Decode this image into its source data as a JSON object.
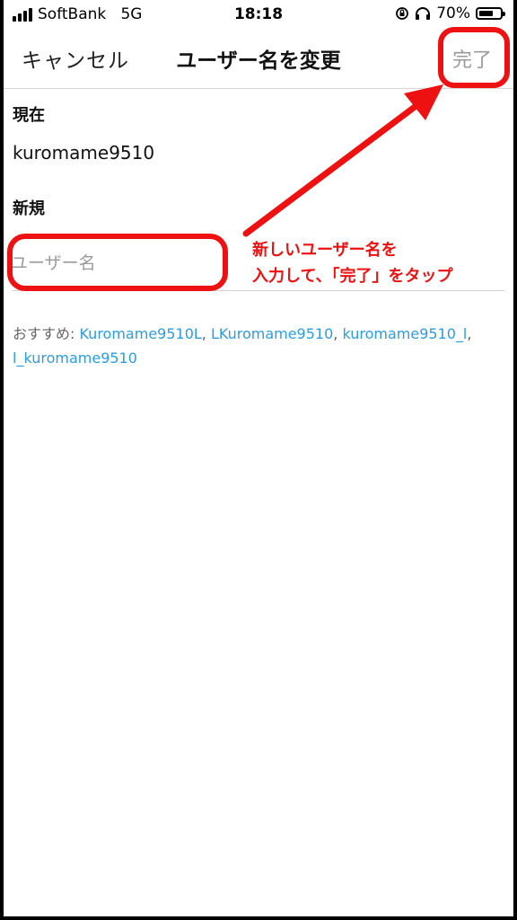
{
  "status_bar": {
    "carrier": "SoftBank",
    "network": "5G",
    "time": "18:18",
    "battery": "70%",
    "battery_level": 0.7,
    "icons": [
      "signal-icon",
      "rotation-lock-icon",
      "headphones-icon",
      "battery-icon"
    ]
  },
  "nav": {
    "cancel_label": "キャンセル",
    "title": "ユーザー名を変更",
    "done_label": "完了"
  },
  "current": {
    "label": "現在",
    "value": "kuromame9510"
  },
  "new_name": {
    "label": "新規",
    "value": "",
    "placeholder": "ユーザー名"
  },
  "suggestions": {
    "prefix": "おすすめ: ",
    "separator": ", ",
    "items": [
      "Kuromame9510L",
      "LKuromame9510",
      "kuromame9510_l",
      "l_kuromame9510"
    ]
  },
  "annotation": {
    "line1": "新しいユーザー名を",
    "line2": "入力して、「完了」をタップ",
    "color": "#ee1111"
  },
  "colors": {
    "link": "#2b9de0",
    "disabled": "#9a9a9a"
  }
}
